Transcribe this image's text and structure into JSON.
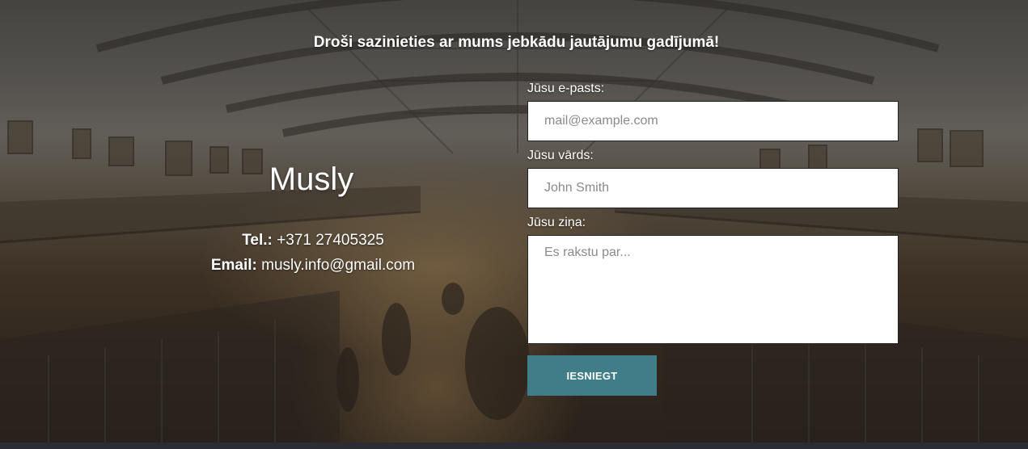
{
  "heading": "Droši sazinieties ar mums jebkādu jautājumu gadījumā!",
  "brand": "Musly",
  "contact": {
    "tel_label": "Tel.:",
    "tel_value": "+371 27405325",
    "email_label": "Email:",
    "email_value": "musly.info@gmail.com"
  },
  "form": {
    "email_label": "Jūsu e-pasts:",
    "email_placeholder": "mail@example.com",
    "name_label": "Jūsu vārds:",
    "name_placeholder": "John Smith",
    "message_label": "Jūsu ziņa:",
    "message_placeholder": "Es rakstu par...",
    "submit_label": "IESNIEGT"
  },
  "colors": {
    "submit_button": "#3f7d89",
    "text": "#ffffff",
    "bottom_strip": "#2b2d33"
  }
}
